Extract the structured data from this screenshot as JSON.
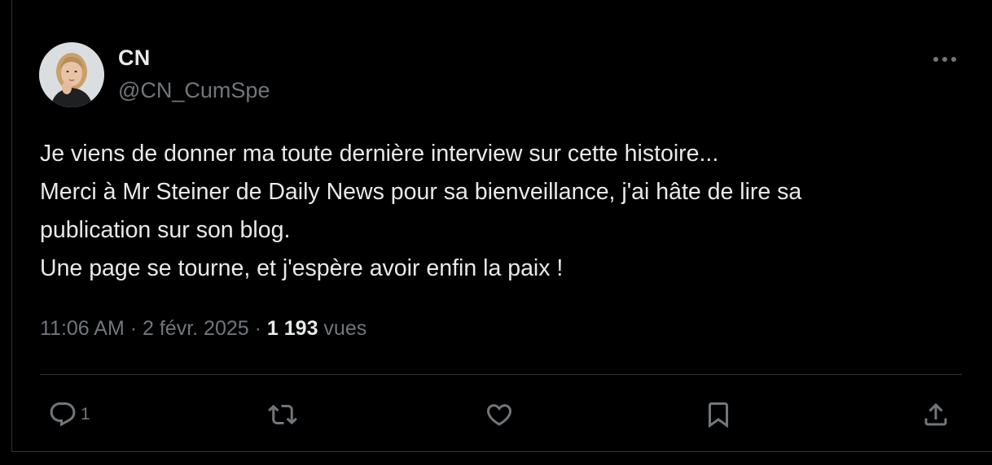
{
  "author": {
    "display_name": "CN",
    "handle": "@CN_CumSpe"
  },
  "tweet": {
    "lines": [
      "Je viens de donner ma toute dernière interview sur cette histoire...",
      "Merci à Mr Steiner de Daily News pour sa bienveillance, j'ai hâte de lire sa",
      "publication sur son blog.",
      "Une page se tourne, et j'espère avoir enfin la paix !"
    ],
    "time": "11:06 AM",
    "separator": "·",
    "date": "2 févr. 2025",
    "views_count": "1 193",
    "views_label": "vues"
  },
  "actions": {
    "reply_count": "1"
  },
  "colors": {
    "background": "#000000",
    "text": "#e7e9ea",
    "muted": "#71767b",
    "border": "#2f3336"
  },
  "icons": [
    "more-horizontal-icon",
    "reply-icon",
    "retweet-icon",
    "like-icon",
    "bookmark-icon",
    "share-icon"
  ]
}
